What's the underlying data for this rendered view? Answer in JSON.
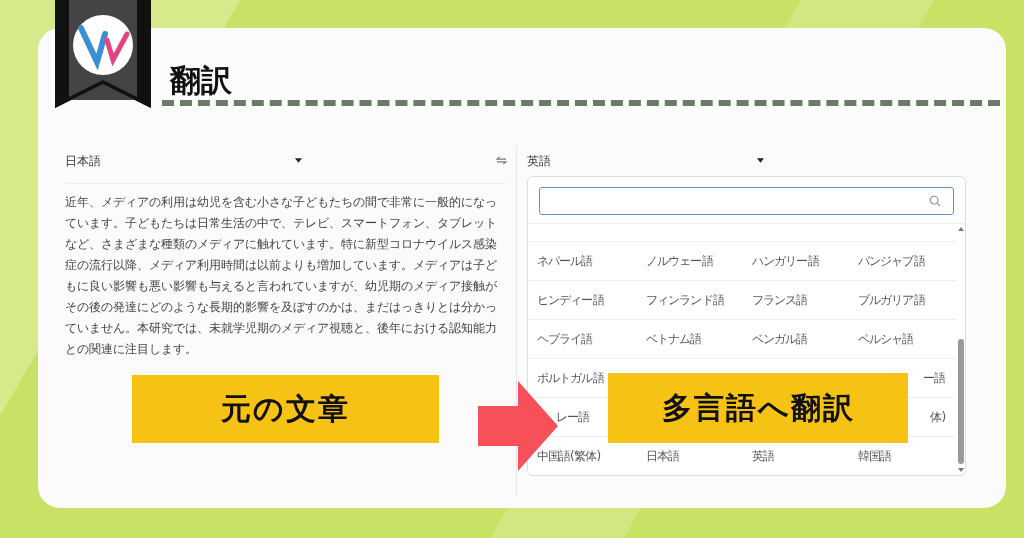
{
  "title": "翻訳",
  "source": {
    "language": "日本語",
    "text": "近年、メディアの利用は幼児を含む小さな子どもたちの間で非常に一般的になっています。子どもたちは日常生活の中で、テレビ、スマートフォン、タブレットなど、さまざまな種類のメディアに触れています。特に新型コロナウイルス感染症の流行以降、メディア利用時間は以前よりも増加しています。メディアは子どもに良い影響も悪い影響も与えると言われていますが、幼児期のメディア接触がその後の発達にどのような長期的影響を及ぼすのかは、まだはっきりとは分かっていません。本研究では、未就学児期のメディア視聴と、後年における認知能力との関連に注目します。"
  },
  "target": {
    "language": "英語",
    "dropdown": {
      "rows": [
        [
          {
            "text": "ネパール語"
          },
          {
            "text": "ノルウェー語"
          },
          {
            "text": "ハンガリー語"
          },
          {
            "text": "パンジャブ語"
          }
        ],
        [
          {
            "text": "ヒンディー語"
          },
          {
            "text": "フィンランド語"
          },
          {
            "text": "フランス語"
          },
          {
            "text": "ブルガリア語"
          }
        ],
        [
          {
            "text": "ヘブライ語"
          },
          {
            "text": "ベトナム語"
          },
          {
            "text": "ベンガル語"
          },
          {
            "text": "ペルシャ語"
          }
        ],
        [
          {
            "text": "ポルトガル語"
          },
          null,
          null,
          {
            "text": "ー語",
            "clipped": true
          }
        ],
        [
          {
            "text": "レー語",
            "clipped": true
          },
          null,
          null,
          {
            "text": "体)",
            "clipped": true
          }
        ],
        [
          {
            "text": "中国語(繁体)"
          },
          {
            "text": "日本語"
          },
          {
            "text": "英語"
          },
          {
            "text": "韓国語"
          }
        ]
      ]
    }
  },
  "callouts": [
    {
      "text": "元の文章"
    },
    {
      "text": "多言語へ翻訳"
    }
  ]
}
